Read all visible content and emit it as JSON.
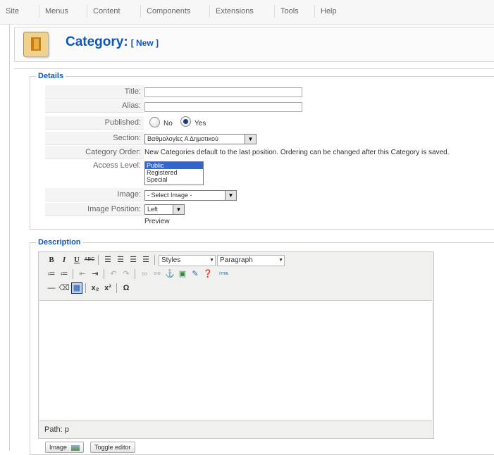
{
  "menu": [
    "Site",
    "Menus",
    "Content",
    "Components",
    "Extensions",
    "Tools",
    "Help"
  ],
  "header": {
    "title": "Category:",
    "subtitle": "[ New ]"
  },
  "details": {
    "legend": "Details",
    "title_label": "Title:",
    "title_value": "",
    "alias_label": "Alias:",
    "alias_value": "",
    "published_label": "Published:",
    "published_no": "No",
    "published_yes": "Yes",
    "published_selected": "Yes",
    "section_label": "Section:",
    "section_value": "Βαθμολογίες Α Δημοτικού",
    "order_label": "Category Order:",
    "order_text": "New Categories default to the last position. Ordering can be changed after this Category is saved.",
    "access_label": "Access Level:",
    "access_options": [
      "Public",
      "Registered",
      "Special"
    ],
    "access_selected": "Public",
    "image_label": "Image:",
    "image_value": "- Select Image -",
    "image_pos_label": "Image Position:",
    "image_pos_value": "Left",
    "preview_label": "Preview"
  },
  "description": {
    "legend": "Description",
    "styles_value": "Styles",
    "format_value": "Paragraph",
    "path": "Path: p",
    "html_btn": "HTML"
  },
  "buttons": {
    "image": "Image",
    "toggle": "Toggle editor"
  },
  "colors": {
    "accent": "#0b55c4",
    "selected": "#3366cc"
  }
}
